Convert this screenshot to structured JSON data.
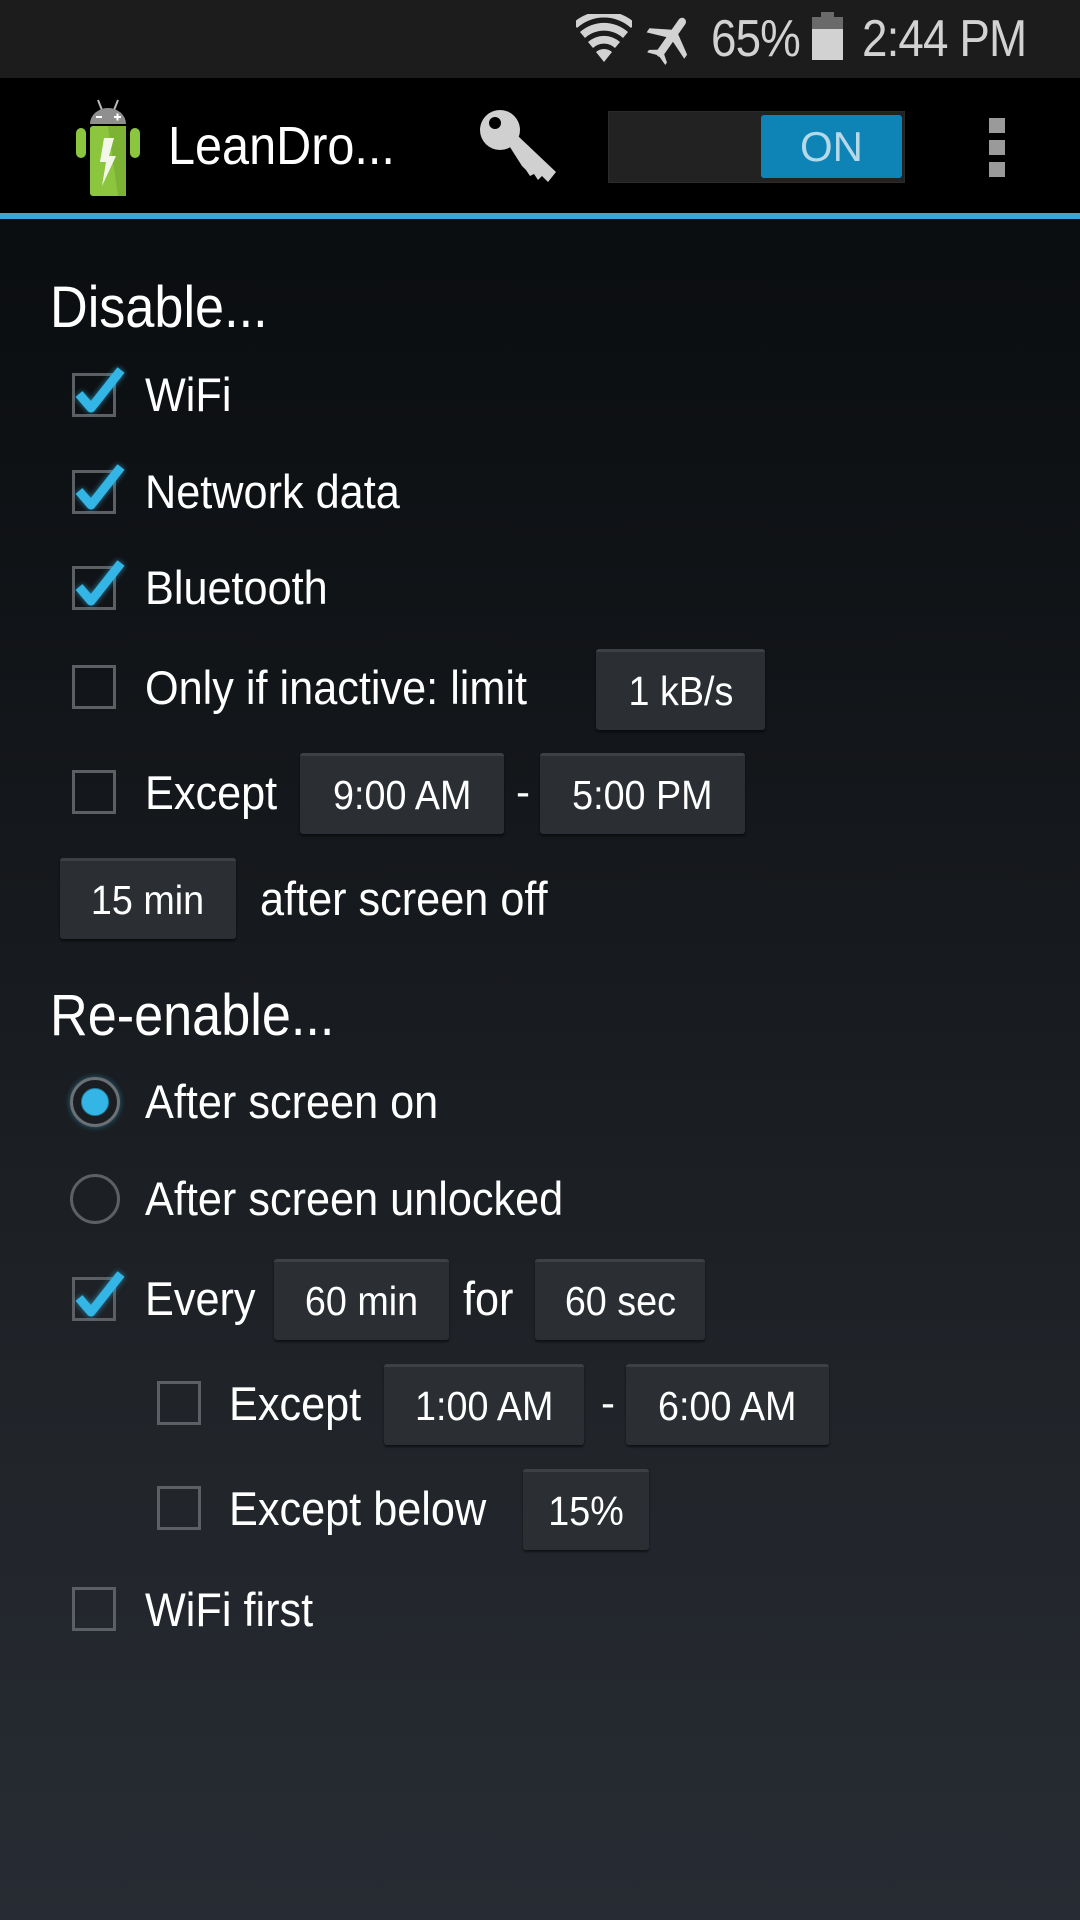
{
  "status_bar": {
    "battery_percent": "65%",
    "time": "2:44 PM",
    "icons": [
      "wifi-icon",
      "airplane-mode-icon",
      "battery-icon"
    ]
  },
  "action_bar": {
    "app_title": "LeanDro...",
    "app_icon": "leandroid-battery-icon",
    "key_icon": "key-icon",
    "toggle_label": "ON",
    "toggle_state": true,
    "overflow_icon": "overflow-menu-icon"
  },
  "disable_section": {
    "heading": "Disable...",
    "wifi": {
      "label": "WiFi",
      "checked": true
    },
    "network_data": {
      "label": "Network data",
      "checked": true
    },
    "bluetooth": {
      "label": "Bluetooth",
      "checked": true
    },
    "only_if_inactive": {
      "label": "Only if inactive: limit",
      "checked": false,
      "value": "1 kB/s"
    },
    "except": {
      "label": "Except",
      "checked": false,
      "from": "9:00 AM",
      "separator": "-",
      "to": "5:00 PM"
    },
    "delay": {
      "value": "15 min",
      "suffix": "after screen off"
    }
  },
  "reenable_section": {
    "heading": "Re-enable...",
    "after_screen_on": {
      "label": "After screen on",
      "selected": true
    },
    "after_screen_unlocked": {
      "label": "After screen unlocked",
      "selected": false
    },
    "every": {
      "label": "Every",
      "checked": true,
      "interval": "60 min",
      "for_label": "for",
      "duration": "60 sec"
    },
    "except_time": {
      "label": "Except",
      "checked": false,
      "from": "1:00 AM",
      "separator": "-",
      "to": "6:00 AM"
    },
    "except_below": {
      "label": "Except below",
      "checked": false,
      "value": "15%"
    },
    "wifi_first": {
      "label": "WiFi first",
      "checked": false
    }
  },
  "colors": {
    "accent": "#33b5e5",
    "action_line": "#3aa6d6",
    "toggle_on": "#0e84b6",
    "app_icon_green": "#8cc63f"
  }
}
